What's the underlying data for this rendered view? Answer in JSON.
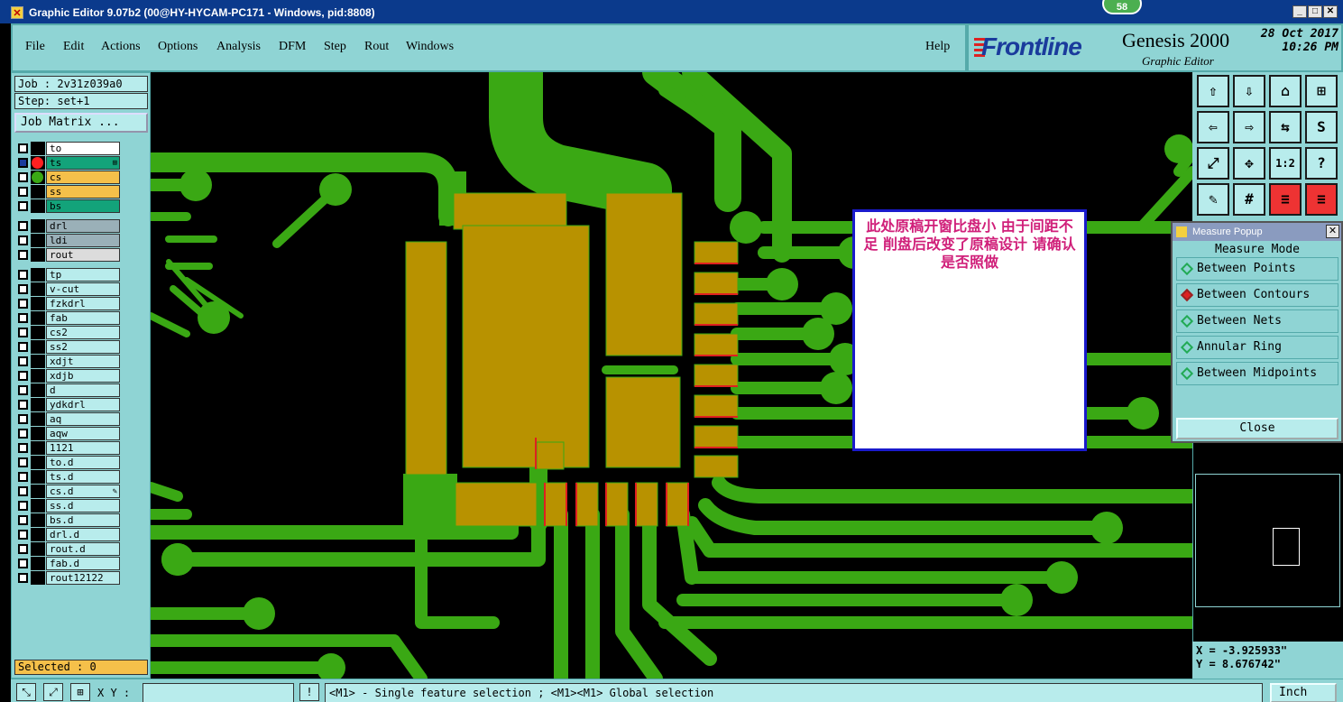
{
  "titlebar": {
    "title": "Graphic Editor 9.07b2 (00@HY-HYCAM-PC171 - Windows, pid:8808)",
    "badge": "58"
  },
  "menu": [
    "File",
    "Edit",
    "Actions",
    "Options",
    "Analysis",
    "DFM",
    "Step",
    "Rout",
    "Windows"
  ],
  "help": "Help",
  "brand": {
    "logo": "Frontline",
    "product": "Genesis 2000",
    "module": "Graphic Editor",
    "date": "28 Oct 2017",
    "time": "10:26 PM"
  },
  "job": {
    "job_label": "Job : 2v31z039a0",
    "step_label": "Step: set+1",
    "matrix_button": "Job Matrix ..."
  },
  "layers": [
    {
      "name": "to",
      "color": "#ffffff",
      "checked": false,
      "dot": ""
    },
    {
      "name": "ts",
      "color": "#13a37a",
      "checked": true,
      "dot": "#ff2020",
      "marker": "⊞"
    },
    {
      "name": "cs",
      "color": "#f5c04a",
      "checked": false,
      "dot": "#3aa814"
    },
    {
      "name": "ss",
      "color": "#f5c04a",
      "checked": false,
      "dot": ""
    },
    {
      "name": "bs",
      "color": "#13a37a",
      "checked": false,
      "dot": ""
    },
    {
      "name": "drl",
      "color": "#9ab0b8",
      "checked": false,
      "dot": ""
    },
    {
      "name": "ldi",
      "color": "#9ab0b8",
      "checked": false,
      "dot": ""
    },
    {
      "name": "rout",
      "color": "#dcdcdc",
      "checked": false,
      "dot": ""
    },
    {
      "name": "tp",
      "color": "#b8ecec",
      "checked": false,
      "dot": ""
    },
    {
      "name": "v-cut",
      "color": "#b8ecec",
      "checked": false,
      "dot": ""
    },
    {
      "name": "fzkdrl",
      "color": "#b8ecec",
      "checked": false,
      "dot": ""
    },
    {
      "name": "fab",
      "color": "#b8ecec",
      "checked": false,
      "dot": ""
    },
    {
      "name": "cs2",
      "color": "#b8ecec",
      "checked": false,
      "dot": ""
    },
    {
      "name": "ss2",
      "color": "#b8ecec",
      "checked": false,
      "dot": ""
    },
    {
      "name": "xdjt",
      "color": "#b8ecec",
      "checked": false,
      "dot": ""
    },
    {
      "name": "xdjb",
      "color": "#b8ecec",
      "checked": false,
      "dot": ""
    },
    {
      "name": "d",
      "color": "#b8ecec",
      "checked": false,
      "dot": ""
    },
    {
      "name": "ydkdrl",
      "color": "#b8ecec",
      "checked": false,
      "dot": ""
    },
    {
      "name": "aq",
      "color": "#b8ecec",
      "checked": false,
      "dot": ""
    },
    {
      "name": "aqw",
      "color": "#b8ecec",
      "checked": false,
      "dot": ""
    },
    {
      "name": "1121",
      "color": "#b8ecec",
      "checked": false,
      "dot": ""
    },
    {
      "name": "to.d",
      "color": "#b8ecec",
      "checked": false,
      "dot": ""
    },
    {
      "name": "ts.d",
      "color": "#b8ecec",
      "checked": false,
      "dot": ""
    },
    {
      "name": "cs.d",
      "color": "#b8ecec",
      "checked": false,
      "dot": "",
      "marker": "✎"
    },
    {
      "name": "ss.d",
      "color": "#b8ecec",
      "checked": false,
      "dot": ""
    },
    {
      "name": "bs.d",
      "color": "#b8ecec",
      "checked": false,
      "dot": ""
    },
    {
      "name": "drl.d",
      "color": "#b8ecec",
      "checked": false,
      "dot": ""
    },
    {
      "name": "rout.d",
      "color": "#b8ecec",
      "checked": false,
      "dot": ""
    },
    {
      "name": "fab.d",
      "color": "#b8ecec",
      "checked": false,
      "dot": ""
    },
    {
      "name": "rout12122",
      "color": "#b8ecec",
      "checked": false,
      "dot": ""
    }
  ],
  "selected": "Selected : 0",
  "note": {
    "text": "此处原稿开窗比盘小   由于间距不足  削盘后改变了原稿设计  请确认是否照做"
  },
  "tools": [
    {
      "icon": "zoom-home-icon",
      "glyph": "⇧"
    },
    {
      "icon": "zoom-down-icon",
      "glyph": "⇩"
    },
    {
      "icon": "home-icon",
      "glyph": "⌂"
    },
    {
      "icon": "fit-window-icon",
      "glyph": "⊞"
    },
    {
      "icon": "pan-left-icon",
      "glyph": "⇦"
    },
    {
      "icon": "pan-right-icon",
      "glyph": "⇨"
    },
    {
      "icon": "mirror-icon",
      "glyph": "⇆"
    },
    {
      "icon": "snap-icon",
      "glyph": "S"
    },
    {
      "icon": "zoom-fit-icon",
      "glyph": "⤢"
    },
    {
      "icon": "zoom-center-icon",
      "glyph": "✥"
    },
    {
      "icon": "scale-1-2-icon",
      "glyph": "1:2"
    },
    {
      "icon": "help-icon",
      "glyph": "?"
    },
    {
      "icon": "palette-icon",
      "glyph": "✎"
    },
    {
      "icon": "grid-icon",
      "glyph": "#"
    },
    {
      "icon": "layers-red-icon",
      "glyph": "≡"
    },
    {
      "icon": "layers-red-2-icon",
      "glyph": "≡"
    }
  ],
  "measure": {
    "title": "Measure Popup",
    "mode_label": "Measure Mode",
    "options": [
      "Between Points",
      "Between Contours",
      "Between Nets",
      "Annular Ring",
      "Between Midpoints"
    ],
    "selected": "Between Contours",
    "close": "Close"
  },
  "coords": {
    "x": "X = -3.925933\"",
    "y": "Y = 8.676742\""
  },
  "status": {
    "xy_label": "X Y :",
    "hint": "<M1> - Single feature selection ; <M1><M1> Global selection",
    "unit": "Inch"
  },
  "colors": {
    "copper": "#3aa814",
    "pad": "#b89200",
    "edge": "#e02020",
    "note_border": "#1a1acc",
    "note_text": "#d0207a"
  }
}
